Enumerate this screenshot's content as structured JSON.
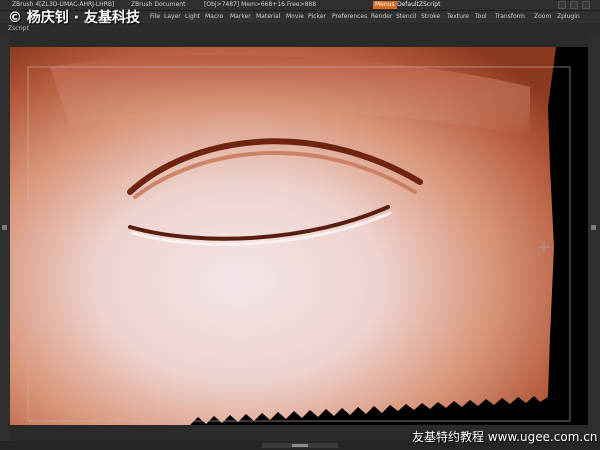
{
  "titlebar": {
    "app": "ZBrush 4[ZL3D-UMAC-AHRJ-LHRB]",
    "doc": "ZBrush Document",
    "stats": "[Obj>7487] Mem>668+16 Free>888",
    "menus_button": "Menus",
    "script": "DefaultZScript"
  },
  "menu": {
    "items": [
      "File",
      "Layer",
      "Light",
      "Macro",
      "Marker",
      "Material",
      "Movie",
      "Picker",
      "Preferences",
      "Render",
      "Stencil",
      "Stroke",
      "Texture",
      "Tool",
      "Transform",
      "Zoom",
      "Zplugin"
    ]
  },
  "zscript_label": "Zscript",
  "watermark": {
    "top_left": "© 杨庆钊 · 友基科技",
    "bottom_right": "友基特约教程 www.ugee.com.cn"
  },
  "colors": {
    "ui_dark": "#2a2a2a",
    "accent": "#d86a1e",
    "skin_dark": "#8c3a1f",
    "skin_light": "#f1dfe0"
  }
}
